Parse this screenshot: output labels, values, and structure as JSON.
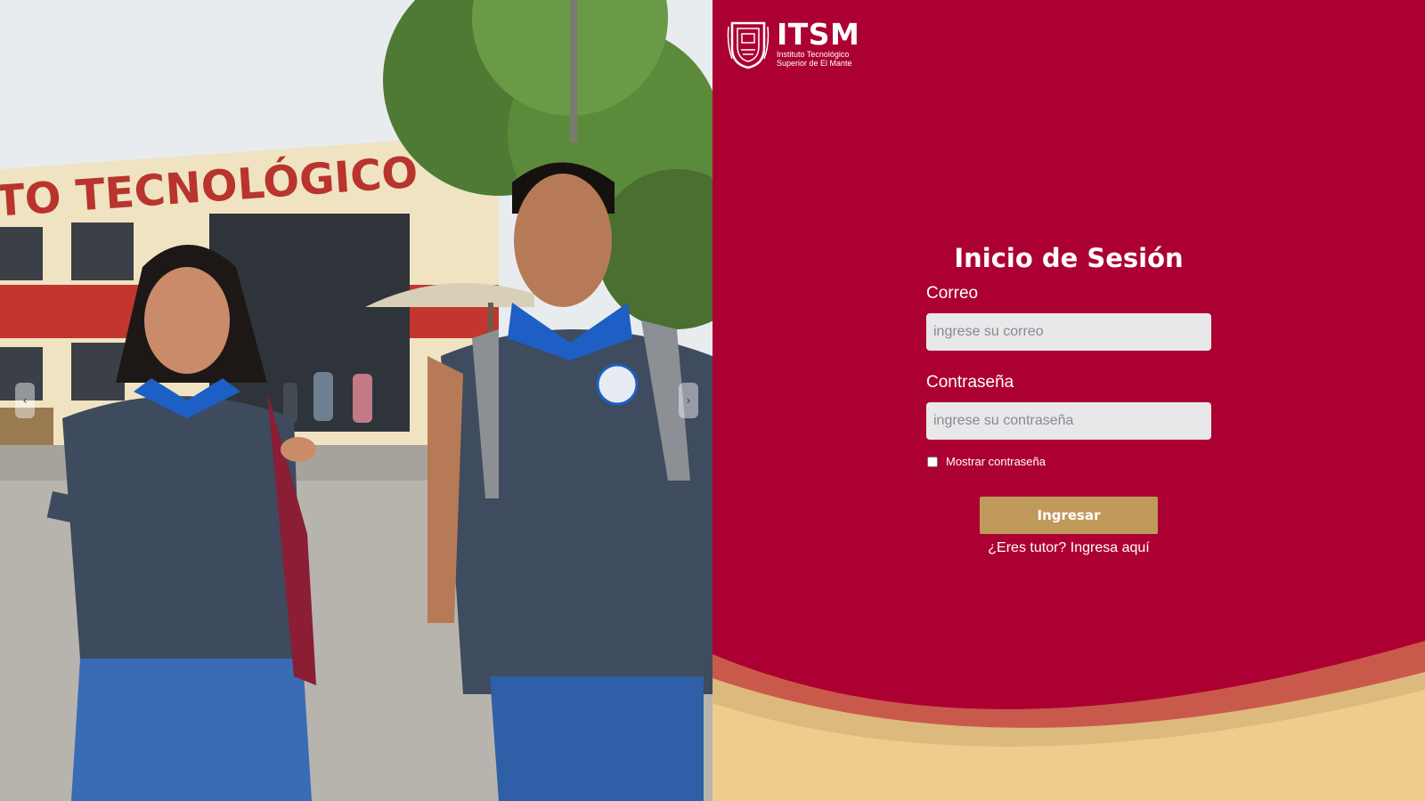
{
  "carousel": {
    "prev_icon": "‹",
    "next_icon": "›",
    "photo": {
      "building_sign": "TO TECNOLÓGICO"
    }
  },
  "brand": {
    "acronym": "ITSM",
    "subtitle_line1": "Instituto Tecnológico",
    "subtitle_line2": "Superior de El Mante"
  },
  "login": {
    "title": "Inicio de Sesión",
    "email_label": "Correo",
    "email_placeholder": "ingrese su correo",
    "email_value": "",
    "password_label": "Contraseña",
    "password_placeholder": "ingrese su contraseña",
    "password_value": "",
    "show_password_label": "Mostrar contraseña",
    "show_password_checked": false,
    "submit_label": "Ingresar",
    "tutor_link": "¿Eres tutor? Ingresa aquí"
  },
  "colors": {
    "primary": "#ac0032",
    "button": "#bf9a5b",
    "wave_red": "#c95a4b",
    "wave_tan": "#dcb97c",
    "wave_light": "#f0cc8c"
  }
}
